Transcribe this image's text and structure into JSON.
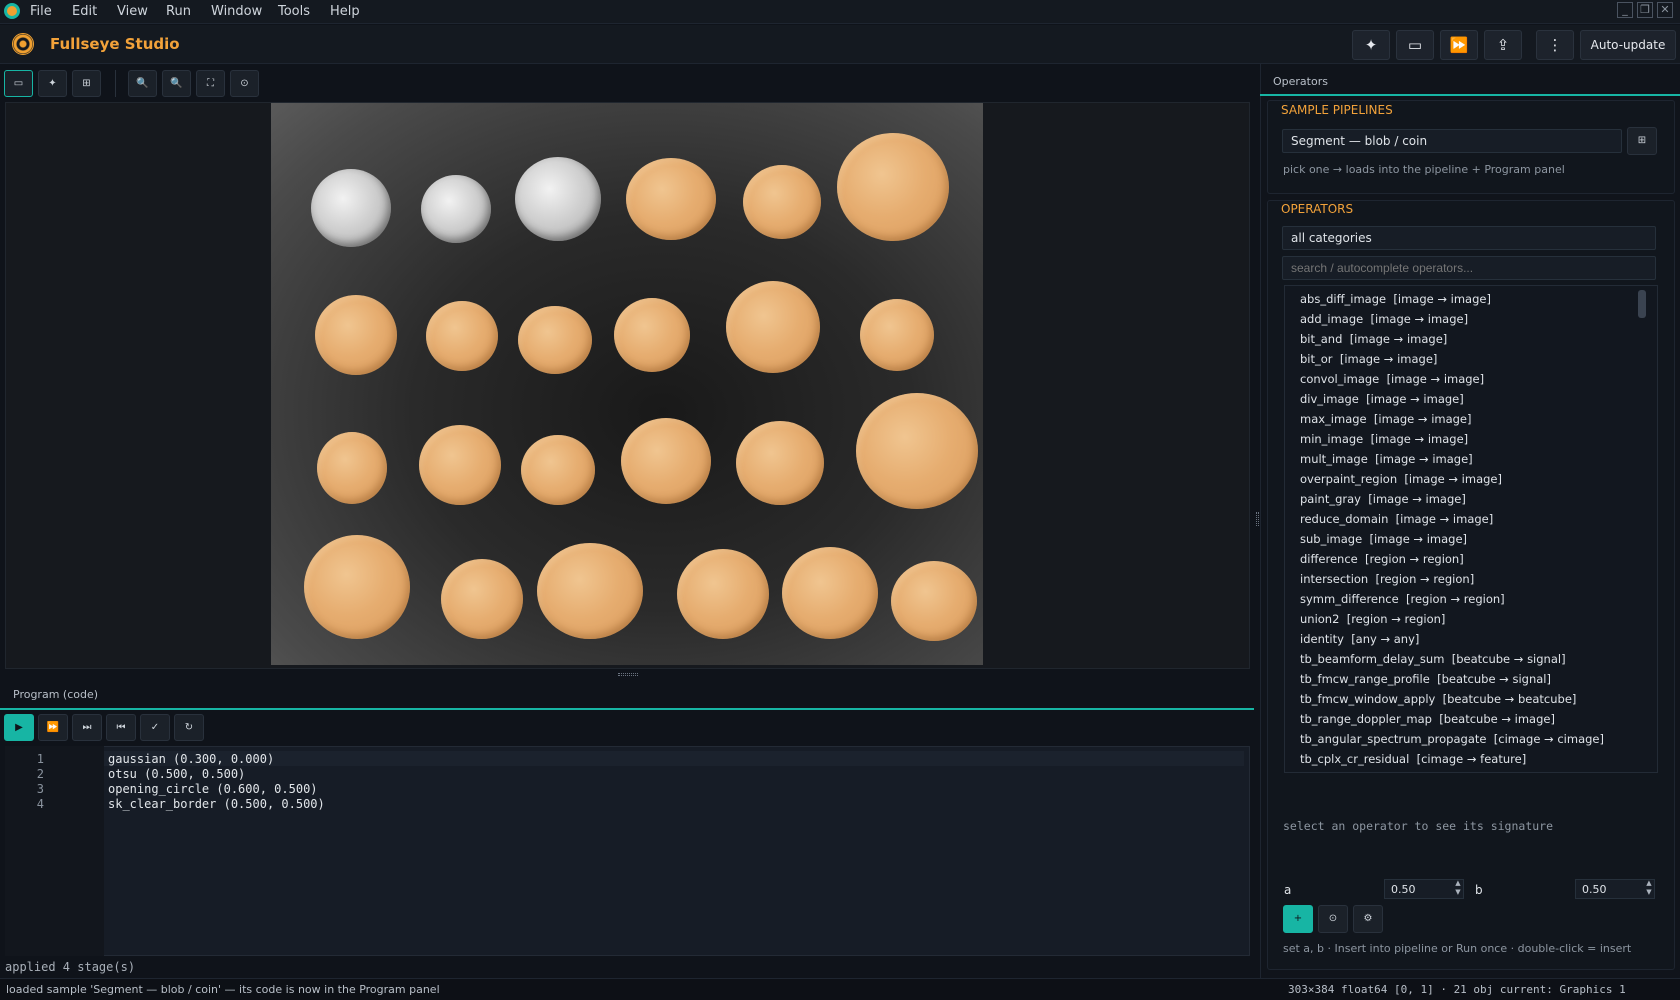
{
  "menubar": {
    "items": [
      "File",
      "Edit",
      "View",
      "Run",
      "Window",
      "Tools",
      "Help"
    ],
    "window_controls": [
      "_",
      "❐",
      "✕"
    ]
  },
  "app": {
    "title": "Fullseye Studio"
  },
  "toolbar": {
    "icons": [
      "✦",
      "▭",
      "⏩",
      "⇪",
      "⋮"
    ],
    "auto_update": "Auto-update"
  },
  "viewer_toolbar": {
    "icons": [
      "▭",
      "✦",
      "⊞",
      "🔍",
      "🔍",
      "⛶",
      "⊙"
    ]
  },
  "program": {
    "tab": "Program (code)",
    "controls": [
      "▶",
      "⏩",
      "⏭",
      "⏮",
      "✓",
      "↻"
    ],
    "lines": [
      {
        "num": "1",
        "code": "gaussian (0.300, 0.000)"
      },
      {
        "num": "2",
        "code": "otsu (0.500, 0.500)"
      },
      {
        "num": "3",
        "code": "opening_circle (0.600, 0.500)"
      },
      {
        "num": "4",
        "code": "sk_clear_border (0.500, 0.500)"
      }
    ],
    "applied": "applied 4 stage(s)"
  },
  "operators_panel": {
    "tab": "Operators",
    "sample_title": "SAMPLE PIPELINES",
    "sample_value": "Segment — blob / coin",
    "sample_hint": "pick one → loads into the pipeline + Program panel",
    "operators_title": "OPERATORS",
    "category": "all categories",
    "search_placeholder": "search / autocomplete operators...",
    "items": [
      "abs_diff_image  [image → image]",
      "add_image  [image → image]",
      "bit_and  [image → image]",
      "bit_or  [image → image]",
      "convol_image  [image → image]",
      "div_image  [image → image]",
      "max_image  [image → image]",
      "min_image  [image → image]",
      "mult_image  [image → image]",
      "overpaint_region  [image → image]",
      "paint_gray  [image → image]",
      "reduce_domain  [image → image]",
      "sub_image  [image → image]",
      "difference  [region → region]",
      "intersection  [region → region]",
      "symm_difference  [region → region]",
      "union2  [region → region]",
      "identity  [any → any]",
      "tb_beamform_delay_sum  [beatcube → signal]",
      "tb_fmcw_range_profile  [beatcube → signal]",
      "tb_fmcw_window_apply  [beatcube → beatcube]",
      "tb_range_doppler_map  [beatcube → image]",
      "tb_angular_spectrum_propagate  [cimage → cimage]",
      "tb_cplx_cr_residual  [cimage → feature]"
    ],
    "signature_hint": "select an operator to see its signature",
    "param_a_label": "a",
    "param_a_value": "0.50",
    "param_b_label": "b",
    "param_b_value": "0.50",
    "action_hint": "set a, b · Insert into pipeline or Run once · double-click = insert"
  },
  "status": {
    "left": "loaded sample 'Segment — blob / coin' — its code is now in the Program panel",
    "right": "303×384 float64 [0, 1] · 21 obj current: Graphics 1"
  },
  "colors": {
    "accent": "#17b5a4",
    "brand": "#f2a23a",
    "coin_overlay": "#e6ad70",
    "background": "#0f131a"
  }
}
